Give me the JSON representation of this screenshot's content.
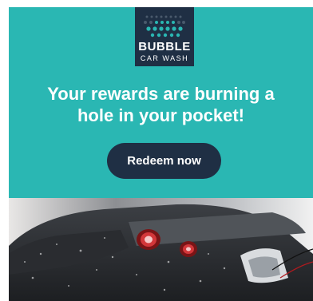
{
  "brand": {
    "logo_line1": "BUBBLE",
    "logo_line2": "CAR WASH",
    "logo_icon": "bubbles-icon",
    "background_color": "#1f2f44",
    "bubble_color": "#2ab7b3"
  },
  "hero": {
    "background_color": "#2ab7b3",
    "headline_line1": "Your rewards are burning a",
    "headline_line2": "hole in your pocket!",
    "cta_label": "Redeem now",
    "cta_color": "#1f2f44"
  },
  "image": {
    "subject": "car-wash-photo"
  }
}
